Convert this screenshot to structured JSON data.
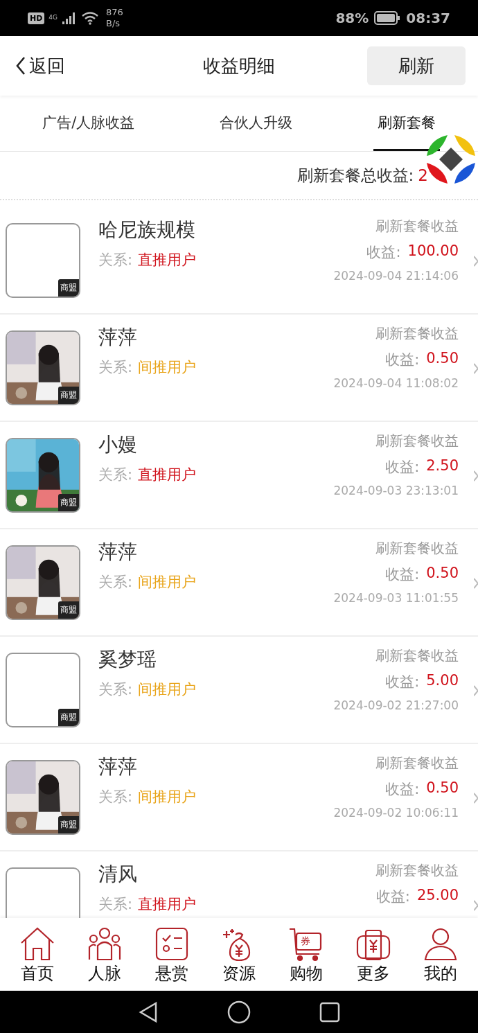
{
  "status_bar": {
    "hd": "HD",
    "network": "4G",
    "speed": "876",
    "speed_unit": "B/s",
    "battery": "88%",
    "time": "08:37"
  },
  "header": {
    "back": "返回",
    "title": "收益明细",
    "action": "刷新"
  },
  "tabs": [
    {
      "label": "广告/人脉收益",
      "selected": false
    },
    {
      "label": "合伙人升级",
      "selected": false
    },
    {
      "label": "刷新套餐",
      "selected": true
    }
  ],
  "total": {
    "label": "刷新套餐总收益:",
    "value": "2"
  },
  "records": [
    {
      "name": "哈尼族规模",
      "has_photo": false,
      "badge": "商盟",
      "relation_label": "关系:",
      "relation": "直推用户",
      "kind": "direct",
      "type": "刷新套餐收益",
      "amount_label": "收益:",
      "amount": "100.00",
      "time": "2024-09-04 21:14:06"
    },
    {
      "name": "萍萍",
      "has_photo": true,
      "badge": "商盟",
      "relation_label": "关系:",
      "relation": "间推用户",
      "kind": "indirect",
      "type": "刷新套餐收益",
      "amount_label": "收益:",
      "amount": "0.50",
      "time": "2024-09-04 11:08:02"
    },
    {
      "name": "小嫚",
      "has_photo": true,
      "badge": "商盟",
      "relation_label": "关系:",
      "relation": "直推用户",
      "kind": "direct",
      "type": "刷新套餐收益",
      "amount_label": "收益:",
      "amount": "2.50",
      "time": "2024-09-03 23:13:01"
    },
    {
      "name": "萍萍",
      "has_photo": true,
      "badge": "商盟",
      "relation_label": "关系:",
      "relation": "间推用户",
      "kind": "indirect",
      "type": "刷新套餐收益",
      "amount_label": "收益:",
      "amount": "0.50",
      "time": "2024-09-03 11:01:55"
    },
    {
      "name": "奚梦瑶",
      "has_photo": false,
      "badge": "商盟",
      "relation_label": "关系:",
      "relation": "间推用户",
      "kind": "indirect",
      "type": "刷新套餐收益",
      "amount_label": "收益:",
      "amount": "5.00",
      "time": "2024-09-02 21:27:00"
    },
    {
      "name": "萍萍",
      "has_photo": true,
      "badge": "商盟",
      "relation_label": "关系:",
      "relation": "间推用户",
      "kind": "indirect",
      "type": "刷新套餐收益",
      "amount_label": "收益:",
      "amount": "0.50",
      "time": "2024-09-02 10:06:11"
    },
    {
      "name": "清风",
      "has_photo": false,
      "relation_label": "关系:",
      "relation": "直推用户",
      "kind": "direct",
      "type": "刷新套餐收益",
      "amount_label": "收益:",
      "amount": "25.00"
    }
  ],
  "bottom_nav": [
    {
      "label": "首页"
    },
    {
      "label": "人脉"
    },
    {
      "label": "悬赏"
    },
    {
      "label": "资源"
    },
    {
      "label": "购物",
      "badge": "券"
    },
    {
      "label": "更多"
    },
    {
      "label": "我的"
    }
  ]
}
